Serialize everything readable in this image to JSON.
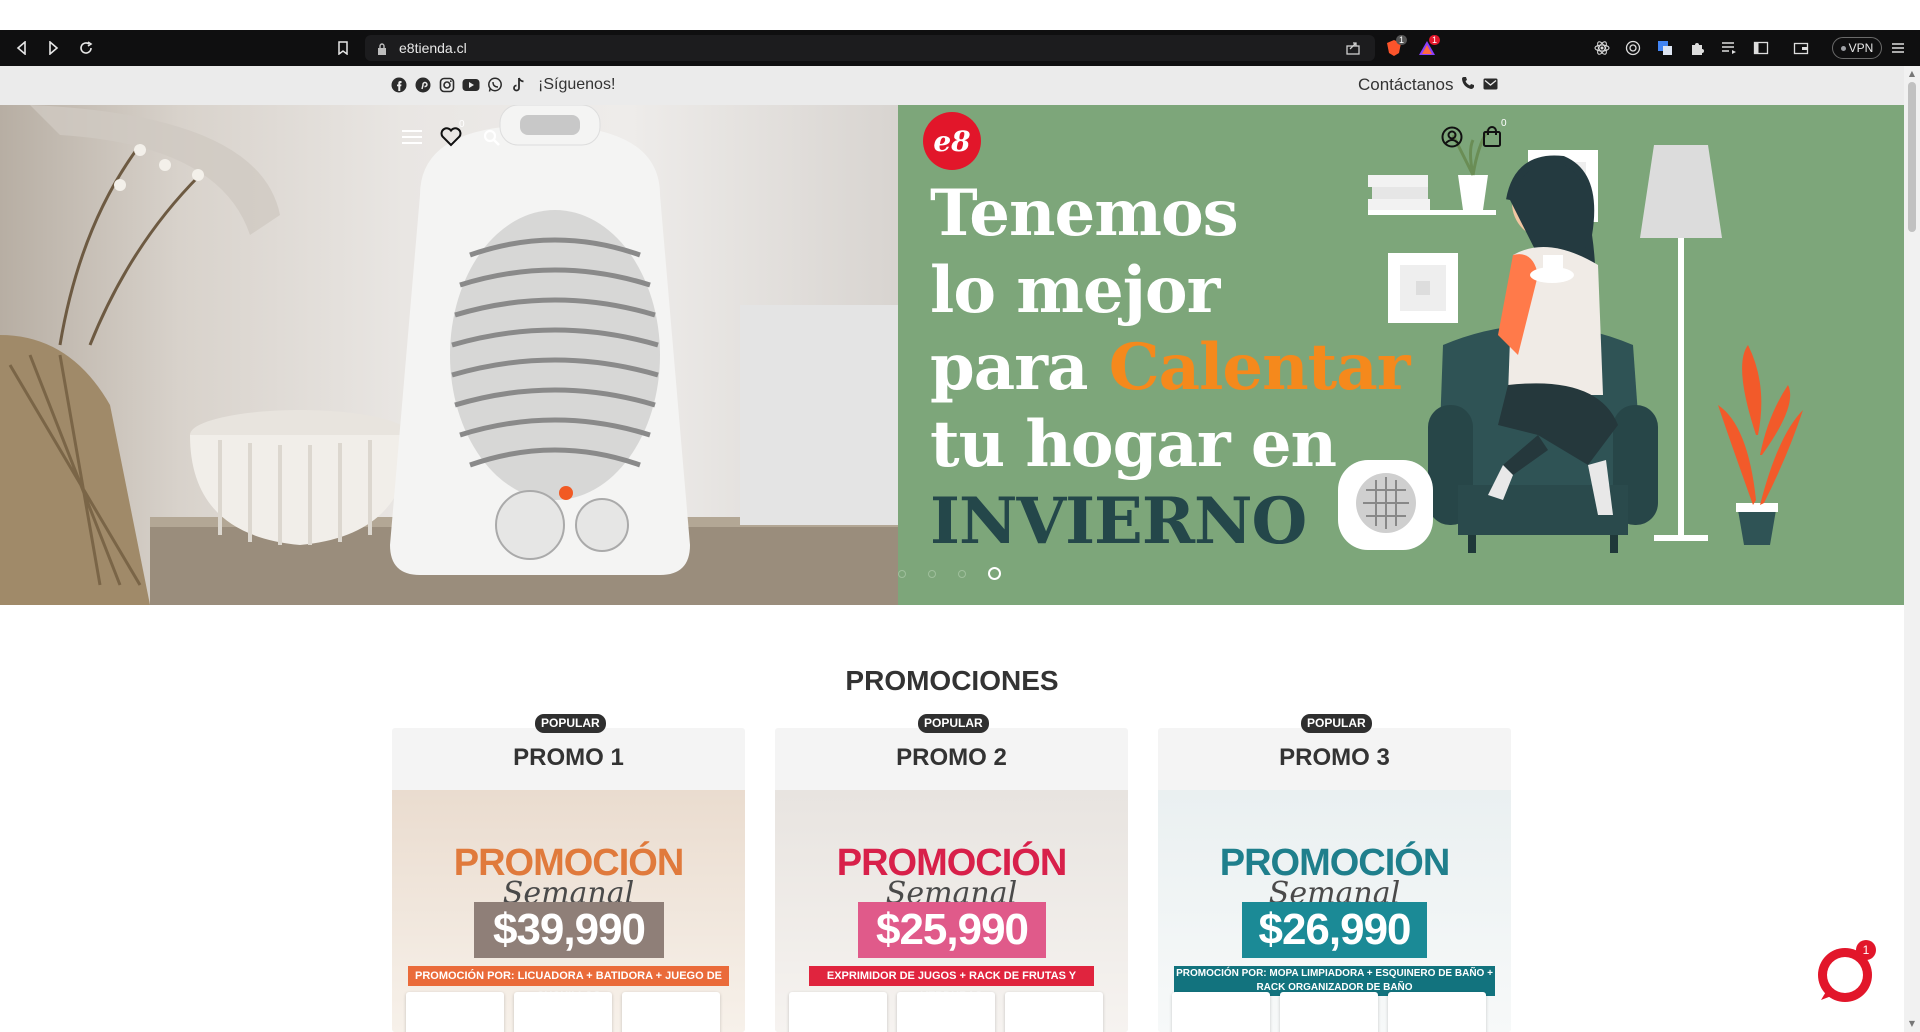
{
  "browser": {
    "url": "e8tienda.cl",
    "vpn_label": "VPN",
    "brave_badge": "1",
    "rewards_badge": "1"
  },
  "social_bar": {
    "follow_text": "¡Síguenos!",
    "contact_text": "Contáctanos",
    "icons": [
      "facebook-icon",
      "pinterest-icon",
      "instagram-icon",
      "youtube-icon",
      "whatsapp-icon",
      "tiktok-icon"
    ]
  },
  "hero": {
    "logo_text": "e8",
    "wishlist_count": "0",
    "cart_count": "0",
    "title_line1": "Tenemos",
    "title_line2": "lo mejor",
    "title_line3_a": "para ",
    "title_line3_b": "Calentar",
    "title_line4": "tu hogar en",
    "title_line5": "INVIERNO",
    "slides": 4,
    "active_slide": 4,
    "colors": {
      "panel": "#7da67a",
      "accent": "#f5891c",
      "dark": "#24474a"
    }
  },
  "promotions": {
    "section_title": "PROMOCIONES",
    "cards": [
      {
        "badge": "POPULAR",
        "title": "PROMO 1",
        "promo_word": "PROMOCIÓN",
        "semanal": "Semanal",
        "price": "$39,990",
        "description": "PROMOCIÓN POR:  LICUADORA + BATIDORA + JUEGO DE CUCHILLOS",
        "colors": {
          "word": "#e07a3c",
          "price_bg": "#8f7f78",
          "strip": "#ea6b3a"
        }
      },
      {
        "badge": "POPULAR",
        "title": "PROMO 2",
        "promo_word": "PROMOCIÓN",
        "semanal": "Semanal",
        "price": "$25,990",
        "description": "EXPRIMIDOR DE JUGOS + RACK DE FRUTAS Y VERDURAS",
        "colors": {
          "word": "#d8204a",
          "price_bg": "#e05a8a",
          "strip": "#e0243e"
        }
      },
      {
        "badge": "POPULAR",
        "title": "PROMO 3",
        "promo_word": "PROMOCIÓN",
        "semanal": "Semanal",
        "price": "$26,990",
        "description": "PROMOCIÓN POR:  MOPA LIMPIADORA + ESQUINERO DE BAÑO + RACK ORGANIZADOR DE BAÑO",
        "colors": {
          "word": "#1f7f8c",
          "price_bg": "#1b8a96",
          "strip": "#12737e"
        }
      }
    ]
  },
  "chat": {
    "unread": "1"
  }
}
